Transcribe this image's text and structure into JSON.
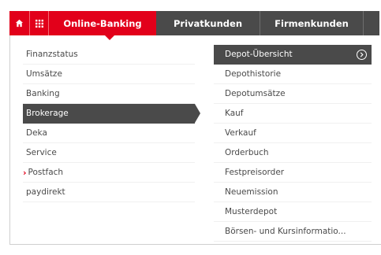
{
  "colors": {
    "brand_red": "#e2001a",
    "dark_gray": "#4a4a4a",
    "text": "#4a4a4a"
  },
  "nav": {
    "home_icon": "home-icon",
    "grid_icon": "apps-grid-icon",
    "tabs": [
      {
        "label": "Online-Banking"
      },
      {
        "label": "Privatkunden"
      },
      {
        "label": "Firmenkunden"
      }
    ]
  },
  "menu": {
    "left": [
      {
        "label": "Finanzstatus"
      },
      {
        "label": "Umsätze"
      },
      {
        "label": "Banking"
      },
      {
        "label": "Brokerage"
      },
      {
        "label": "Deka"
      },
      {
        "label": "Service"
      },
      {
        "label": "Postfach"
      },
      {
        "label": "paydirekt"
      }
    ],
    "right": [
      {
        "label": "Depot-Übersicht"
      },
      {
        "label": "Depothistorie"
      },
      {
        "label": "Depotumsätze"
      },
      {
        "label": "Kauf"
      },
      {
        "label": "Verkauf"
      },
      {
        "label": "Orderbuch"
      },
      {
        "label": "Festpreisorder"
      },
      {
        "label": "Neuemission"
      },
      {
        "label": "Musterdepot"
      },
      {
        "label": "Börsen- und Kursinformatio..."
      }
    ]
  }
}
